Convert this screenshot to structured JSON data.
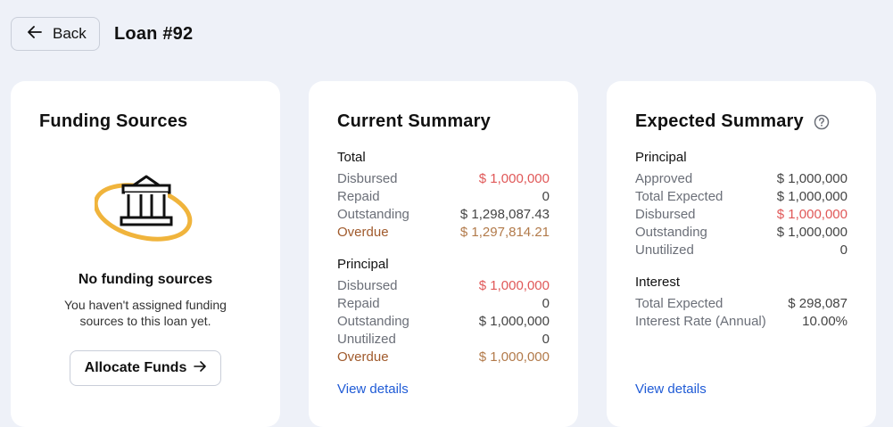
{
  "header": {
    "back_label": "Back",
    "title": "Loan #92"
  },
  "funding": {
    "title": "Funding Sources",
    "empty_title": "No funding sources",
    "empty_desc_line1": "You haven't assigned funding",
    "empty_desc_line2": "sources to this loan yet.",
    "allocate_label": "Allocate Funds",
    "icon": "bank-icon"
  },
  "current": {
    "title": "Current Summary",
    "total": {
      "heading": "Total",
      "rows": [
        {
          "label": "Disbursed",
          "value": "$ 1,000,000"
        },
        {
          "label": "Repaid",
          "value": "0"
        },
        {
          "label": "Outstanding",
          "value": "$ 1,298,087.43"
        },
        {
          "label": "Overdue",
          "value": "$ 1,297,814.21"
        }
      ]
    },
    "principal": {
      "heading": "Principal",
      "rows": [
        {
          "label": "Disbursed",
          "value": "$ 1,000,000"
        },
        {
          "label": "Repaid",
          "value": "0"
        },
        {
          "label": "Outstanding",
          "value": "$ 1,000,000"
        },
        {
          "label": "Unutilized",
          "value": "0"
        },
        {
          "label": "Overdue",
          "value": "$ 1,000,000"
        }
      ]
    },
    "view_details": "View details"
  },
  "expected": {
    "title": "Expected Summary",
    "help_icon": "question-circle-icon",
    "principal": {
      "heading": "Principal",
      "rows": [
        {
          "label": "Approved",
          "value": "$ 1,000,000"
        },
        {
          "label": "Total Expected",
          "value": "$ 1,000,000"
        },
        {
          "label": "Disbursed",
          "value": "$ 1,000,000"
        },
        {
          "label": "Outstanding",
          "value": "$ 1,000,000"
        },
        {
          "label": "Unutilized",
          "value": "0"
        }
      ]
    },
    "interest": {
      "heading": "Interest",
      "rows": [
        {
          "label": "Total Expected",
          "value": "$ 298,087"
        },
        {
          "label": "Interest Rate (Annual)",
          "value": "10.00%"
        }
      ]
    },
    "view_details": "View details"
  },
  "colors": {
    "background": "#eef1f8",
    "link": "#1f5bd6",
    "disbursed_red": "#e05858",
    "overdue_brown": "#a05a2c",
    "icon_gold": "#f0b43c"
  }
}
